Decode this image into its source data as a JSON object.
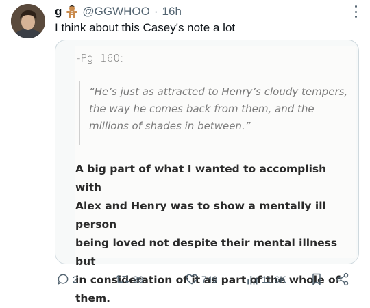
{
  "tweet": {
    "display_name": "g",
    "handle": "@GGWHOO",
    "separator": "·",
    "time": "16h",
    "text": "I think about this Casey's note a lot"
  },
  "image": {
    "page_label": "-Pg. 160:",
    "quote_lines": [
      "“He’s just as attracted to Henry’s cloudy tempers,",
      "the way he comes back from them, and the",
      "millions of shades in between.”"
    ],
    "body_lines": [
      "A big part of what I wanted to accomplish with",
      "Alex and Henry was to show a mentally ill person",
      "being loved not despite their mental illness but",
      "in consideration of it as part of the whole of",
      "them."
    ]
  },
  "actions": {
    "replies": "2",
    "retweets": "89",
    "likes": "749",
    "views": "11.6K"
  },
  "colors": {
    "muted": "#536471",
    "text": "#0f1419",
    "border": "#cfd9de"
  }
}
